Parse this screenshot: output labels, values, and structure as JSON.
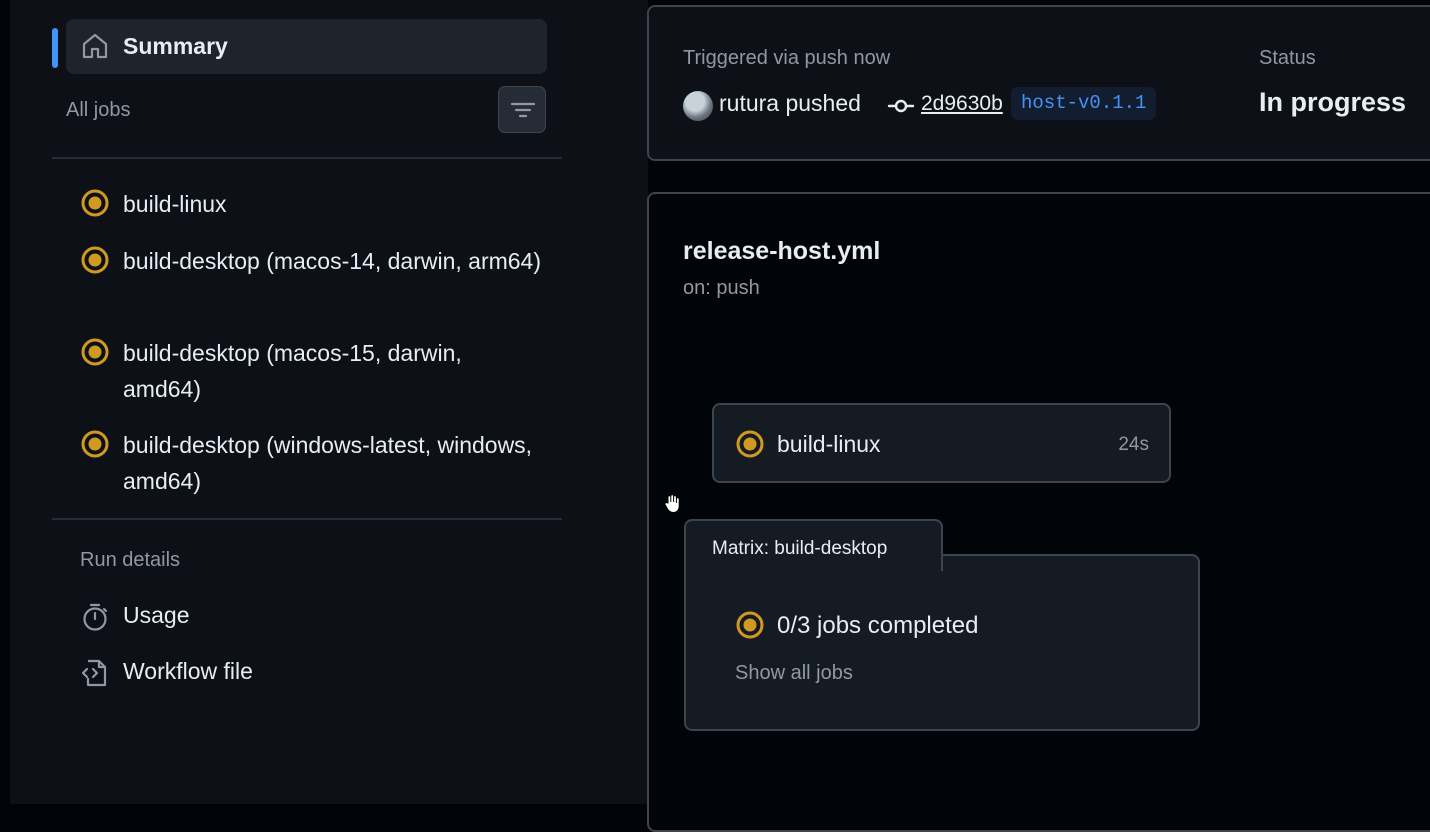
{
  "sidebar": {
    "summary_label": "Summary",
    "all_jobs_label": "All jobs",
    "jobs": [
      {
        "name": "build-linux",
        "status": "in_progress"
      },
      {
        "name": "build-desktop (macos-14, darwin, arm64)",
        "status": "in_progress"
      },
      {
        "name": "build-desktop (macos-15, darwin, amd64)",
        "status": "in_progress"
      },
      {
        "name": "build-desktop (windows-latest, windows, amd64)",
        "status": "in_progress"
      }
    ],
    "run_details_label": "Run details",
    "usage_label": "Usage",
    "workflow_file_label": "Workflow file"
  },
  "header": {
    "triggered_label": "Triggered via push now",
    "pusher_text": "rutura pushed",
    "commit_sha": "2d9630b",
    "tag": "host-v0.1.1",
    "status_label": "Status",
    "status_value": "In progress"
  },
  "workflow": {
    "file": "release-host.yml",
    "trigger": "on: push",
    "job_card": {
      "name": "build-linux",
      "duration": "24s"
    },
    "matrix": {
      "title": "Matrix: build-desktop",
      "progress": "0/3 jobs completed",
      "show_all": "Show all jobs"
    }
  },
  "colors": {
    "in_progress": "#d29922",
    "accent": "#4493f8",
    "background": "#010409",
    "sidebar": "#0d1117"
  }
}
